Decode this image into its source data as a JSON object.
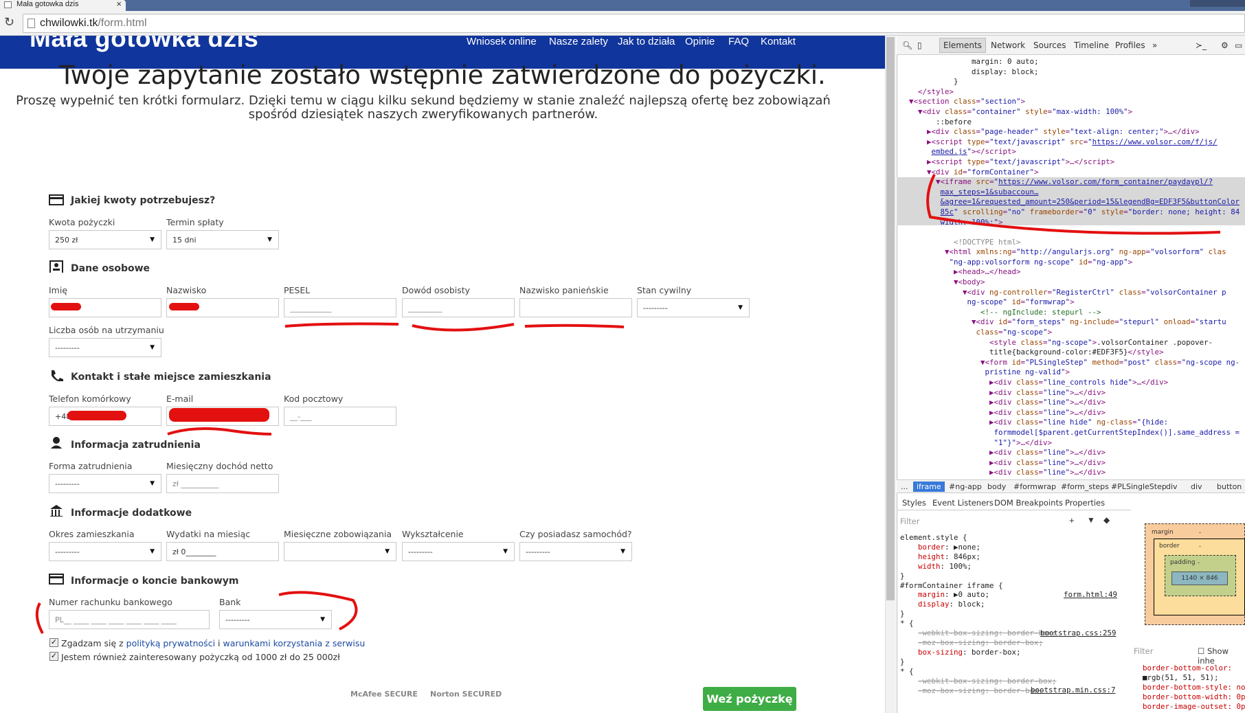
{
  "browser": {
    "tab_title": "Mała gotowka dzis",
    "tab_close": "×",
    "url_host": "chwilowki.tk",
    "url_path": "/form.html"
  },
  "nav": {
    "logo": "Mała gotowka dzis",
    "links": [
      "Wniosek online",
      "Nasze zalety",
      "Jak to działa",
      "Opinie",
      "FAQ",
      "Kontakt"
    ]
  },
  "hero": {
    "title": "Twoje zapytanie zostało wstępnie zatwierdzone do pożyczki.",
    "subtitle_line1": "Proszę wypełnić ten krótki formularz. Dzięki temu w ciągu kilku sekund będziemy w stanie znaleźć najlepszą ofertę bez zobowiązań",
    "subtitle_line2": "spośród dziesiątek naszych zweryfikowanych partnerów."
  },
  "form": {
    "sec_amount": "Jakiej kwoty potrzebujesz?",
    "kwota_label": "Kwota pożyczki",
    "kwota_value": "250 zł",
    "termin_label": "Termin spłaty",
    "termin_value": "15 dni",
    "sec_personal": "Dane osobowe",
    "imie_label": "Imię",
    "nazwisko_label": "Nazwisko",
    "pesel_label": "PESEL",
    "pesel_placeholder": "___________",
    "dowod_label": "Dowód osobisty",
    "dowod_placeholder": "_________",
    "panienskie_label": "Nazwisko panieńskie",
    "stan_label": "Stan cywilny",
    "stan_value": "---------",
    "osoby_label": "Liczba osób na utrzymaniu",
    "osoby_value": "---------",
    "sec_contact": "Kontakt i stałe miejsce zamieszkania",
    "telefon_label": "Telefon komórkowy",
    "telefon_prefix": "+48",
    "email_label": "E-mail",
    "kod_label": "Kod pocztowy",
    "kod_placeholder": "__-___",
    "sec_employment": "Informacja zatrudnienia",
    "forma_label": "Forma zatrudnienia",
    "forma_value": "---------",
    "dochod_label": "Miesięczny dochód netto",
    "dochod_placeholder": "zł __________",
    "sec_additional": "Informacje dodatkowe",
    "okres_label": "Okres zamieszkania",
    "okres_value": "---------",
    "wydatki_label": "Wydatki na miesiąc",
    "wydatki_value": "zł 0________",
    "zobowiazania_label": "Miesięczne zobowiązania",
    "zobowiazania_value": "",
    "wyksztalcenie_label": "Wykształcenie",
    "wyksztalcenie_value": "---------",
    "samochod_label": "Czy posiadasz samochód?",
    "samochod_value": "---------",
    "sec_bank": "Informacje o koncie bankowym",
    "rachunek_label": "Numer rachunku bankowego",
    "rachunek_placeholder": "PL__ ____ ____ ____ ____ ____ ____",
    "bank_label": "Bank",
    "bank_value": "---------",
    "agree1_pre": "Zgadzam się z ",
    "agree1_link1": "polityką prywatności",
    "agree1_mid": " i ",
    "agree1_link2": "warunkami korzystania z serwisu",
    "agree2": "Jestem również zainteresowany pożyczką od 1000 zł do 25 000zł",
    "submit": "Weź pożyczkę",
    "badge_mcafee": "McAfee SECURE",
    "badge_norton": "Norton SECURED"
  },
  "devtools": {
    "tabs": [
      "Elements",
      "Network",
      "Sources",
      "Timeline",
      "Profiles",
      "»"
    ],
    "breadcrumbs": [
      "...",
      "iframe",
      "#ng-app",
      "body",
      "#formwrap",
      "#form_steps",
      "#PLSingleStep",
      "div",
      "div",
      "button"
    ],
    "style_tabs": [
      "Styles",
      "Event Listeners",
      "DOM Breakpoints",
      "Properties"
    ],
    "filter": "Filter",
    "show_inherited": "Show inhe",
    "box_margin": "margin",
    "box_border": "border",
    "box_padding": "padding",
    "box_dash": "-",
    "box_size": "1140 × 846",
    "rule1_link": "form.html:49",
    "rule2_link": "bootstrap.css:259",
    "rule3_link": "bootstrap.min.css:7"
  },
  "colors": {
    "nav_bg": "#10359c",
    "submit_bg": "#3fad46",
    "annotation_red": "#e31010",
    "devtools_selection": "#d8d8d8"
  }
}
